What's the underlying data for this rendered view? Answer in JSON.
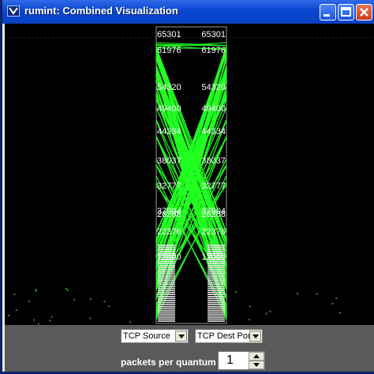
{
  "window": {
    "title": "rumint: Combined Visualization"
  },
  "titlebar_buttons": [
    {
      "name": "minimize-icon"
    },
    {
      "name": "maximize-icon"
    },
    {
      "name": "close-icon"
    }
  ],
  "axis_labels": {
    "left": [
      "65301",
      "61976",
      "54320",
      "49400",
      "44334",
      "38037",
      "32777",
      "37904",
      "26208",
      "22376",
      "12000"
    ],
    "right": [
      "65301",
      "61976",
      "54320",
      "49400",
      "44334",
      "38037",
      "32777",
      "37904",
      "26208",
      "22376",
      "12000"
    ]
  },
  "controls": {
    "left_select": "TCP Source",
    "right_select": "TCP Dest Por",
    "packets_label": "packets per quantum",
    "packets_value": "1"
  },
  "colors": {
    "line": "#21ff21",
    "axis": "#9a9a9a",
    "dots": "#2e8f2e"
  }
}
